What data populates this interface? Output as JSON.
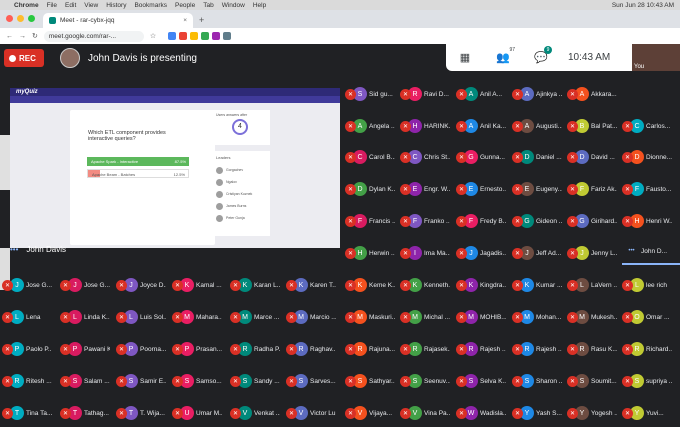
{
  "menubar": {
    "app": "Chrome",
    "items": [
      "File",
      "Edit",
      "View",
      "History",
      "Bookmarks",
      "People",
      "Tab",
      "Window",
      "Help"
    ],
    "clock": "Sun Jun 28  10:43 AM"
  },
  "browser": {
    "tab_title": "Meet - rar-cybx-jqq",
    "url": "meet.google.com/rar-..."
  },
  "meet": {
    "rec_label": "REC",
    "presenting_text": "John Davis is presenting",
    "participants_count": "97",
    "chat_count": "9",
    "clock": "10:43 AM",
    "self_label": "You",
    "presenter_tile_label": "John Davis",
    "pinned_label": "John D..."
  },
  "presentation": {
    "logo": "myQuiz",
    "question": "Which ETL component provides interactive queries?",
    "answer1": "Apache Spark - Interactive",
    "answer1_pct": "87.5%",
    "answer2": "Apache Beam - Batches",
    "answer2_pct": "12.5%",
    "counter": "4",
    "counter_label": "Users answers after",
    "leaders_label": "Leaders",
    "leaders": [
      "Gorgachev",
      "Ngalov",
      "Cristiyan Kuznek",
      "James Burns",
      "Peter Gunja"
    ]
  },
  "participants": [
    [
      "Sid gu...",
      "Ravi D...",
      "Anil A...",
      "Ajinkya ...",
      "Akkara..."
    ],
    [
      "Angela ...",
      "HARINK...",
      "Anil Ka...",
      "Augusti...",
      "Bal Pat...",
      "Carlos..."
    ],
    [
      "Carol B...",
      "Chris St...",
      "Gunna...",
      "Daniel ...",
      "David ...",
      "Dionne..."
    ],
    [
      "Dylan K...",
      "Engr. W...",
      "Ernesto...",
      "Eugeny...",
      "Fariz Ak...",
      "Fausto..."
    ],
    [
      "Francis ...",
      "Franko ...",
      "Fredy B...",
      "Gideon ...",
      "Girihard...",
      "Henri W..."
    ],
    [
      "Herwin ...",
      "Ima Ma...",
      "Jagadis...",
      "Jeff Ad...",
      "Jenny L..."
    ],
    [
      "Jose G...",
      "Jose G...",
      "Joyce D...",
      "Kamal ...",
      "Karan L...",
      "Karen T..."
    ],
    [
      "Keme K...",
      "Kenneth...",
      "Kingdra...",
      "Kumar ...",
      "LaVern ...",
      "lee rich"
    ],
    [
      "Lena",
      "Linda K...",
      "Luis Sol...",
      "Mahara...",
      "Marce ...",
      "Marcio ..."
    ],
    [
      "Maskuri...",
      "Michal ...",
      "MOHIB...",
      "Mohan...",
      "Mukesh...",
      "Omar ..."
    ],
    [
      "Paolo P...",
      "Pawani K...",
      "Poorna...",
      "Prasan...",
      "Radha P...",
      "Raghav..."
    ],
    [
      "Rajuna...",
      "Rajasek...",
      "Rajesh ...",
      "Rajesh ...",
      "Rasu K...",
      "Richard..."
    ],
    [
      "Ritesh ...",
      "Salam ...",
      "Samir E...",
      "Samso...",
      "Sandy ...",
      "Sarves..."
    ],
    [
      "Sathyar...",
      "Seenuv...",
      "Selva K...",
      "Sharon ...",
      "Soumit...",
      "supriya ..."
    ],
    [
      "Tina Ta...",
      "Tathag...",
      "T. Wija...",
      "Umar M...",
      "Venkat ...",
      "Victor Lu"
    ],
    [
      "Vijaya...",
      "Vina Pa...",
      "Wadisla...",
      "Yash S...",
      "Yogesh ...",
      "Yuvi..."
    ]
  ],
  "colors": {
    "mute": "#d93025",
    "rec": "#d93025",
    "accent": "#8ab4f8",
    "quiz_purple": "#2e2a77"
  }
}
